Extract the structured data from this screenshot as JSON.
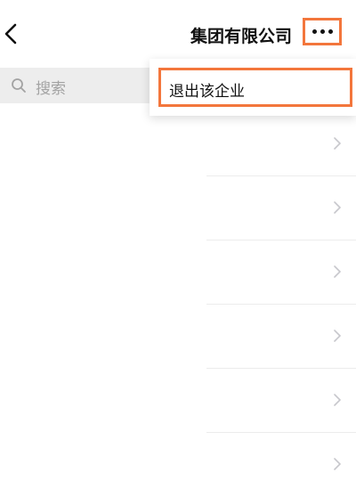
{
  "header": {
    "title": "集团有限公司",
    "back_icon": "chevron-left-icon",
    "more_icon": "more-dots-icon"
  },
  "search": {
    "icon": "search-icon",
    "placeholder": "搜索"
  },
  "list": {
    "row_icon": "chevron-right-icon",
    "row_count": 6
  },
  "menu": {
    "items": [
      {
        "label": "退出该企业"
      }
    ]
  },
  "colors": {
    "highlight": "#f3763c",
    "search_background": "#ededed",
    "placeholder_text": "#a3a3a3",
    "chevron": "#c7c7cc"
  }
}
